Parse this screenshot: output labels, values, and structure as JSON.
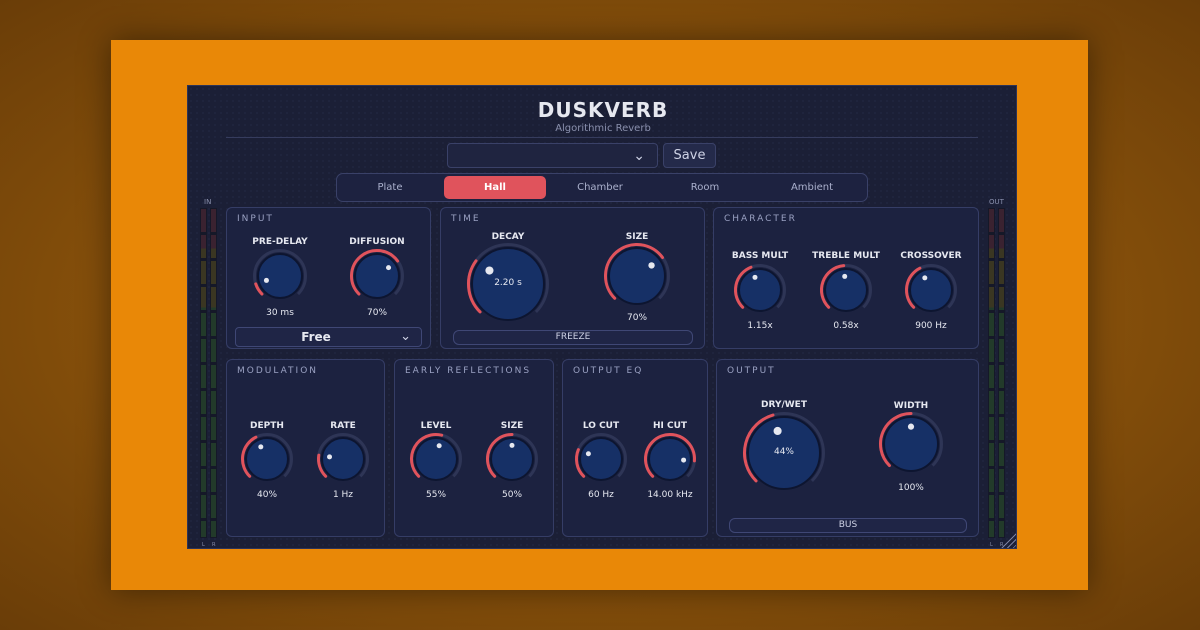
{
  "app": {
    "title": "DUSKVERB",
    "subtitle": "Algorithmic Reverb"
  },
  "preset": {
    "selected": "",
    "save_label": "Save"
  },
  "tabs": [
    {
      "label": "Plate",
      "active": false
    },
    {
      "label": "Hall",
      "active": true
    },
    {
      "label": "Chamber",
      "active": false
    },
    {
      "label": "Room",
      "active": false
    },
    {
      "label": "Ambient",
      "active": false
    }
  ],
  "meters": {
    "in_label": "IN",
    "out_label": "OUT",
    "left": "L",
    "right": "R"
  },
  "colors": {
    "accent": "#e0535c",
    "panel_bg": "#1c2240",
    "knob_fill": "#163066",
    "frame": "#e98807"
  },
  "panels": {
    "input": {
      "title": "INPUT",
      "knobs": [
        {
          "label": "PRE-DELAY",
          "value": "30 ms",
          "level": 0.1
        },
        {
          "label": "DIFFUSION",
          "value": "70%",
          "level": 0.7
        }
      ],
      "mode_value": "Free"
    },
    "time": {
      "title": "TIME",
      "knobs": [
        {
          "label": "DECAY",
          "value": "2.20 s",
          "level": 0.3
        },
        {
          "label": "SIZE",
          "value": "70%",
          "level": 0.7
        }
      ],
      "freeze_label": "FREEZE"
    },
    "character": {
      "title": "CHARACTER",
      "knobs": [
        {
          "label": "BASS MULT",
          "value": "1.15x",
          "level": 0.42
        },
        {
          "label": "TREBLE MULT",
          "value": "0.58x",
          "level": 0.48
        },
        {
          "label": "CROSSOVER",
          "value": "900 Hz",
          "level": 0.4
        }
      ]
    },
    "modulation": {
      "title": "MODULATION",
      "knobs": [
        {
          "label": "DEPTH",
          "value": "40%",
          "level": 0.4
        },
        {
          "label": "RATE",
          "value": "1 Hz",
          "level": 0.2
        }
      ]
    },
    "early_reflections": {
      "title": "EARLY REFLECTIONS",
      "knobs": [
        {
          "label": "LEVEL",
          "value": "55%",
          "level": 0.55
        },
        {
          "label": "SIZE",
          "value": "50%",
          "level": 0.5
        }
      ]
    },
    "output_eq": {
      "title": "OUTPUT EQ",
      "knobs": [
        {
          "label": "LO CUT",
          "value": "60 Hz",
          "level": 0.25
        },
        {
          "label": "HI CUT",
          "value": "14.00 kHz",
          "level": 0.85
        }
      ]
    },
    "output": {
      "title": "OUTPUT",
      "knobs": [
        {
          "label": "DRY/WET",
          "value": "44%",
          "level": 0.44
        },
        {
          "label": "WIDTH",
          "value": "100%",
          "level": 0.5
        }
      ],
      "bus_label": "BUS"
    }
  }
}
